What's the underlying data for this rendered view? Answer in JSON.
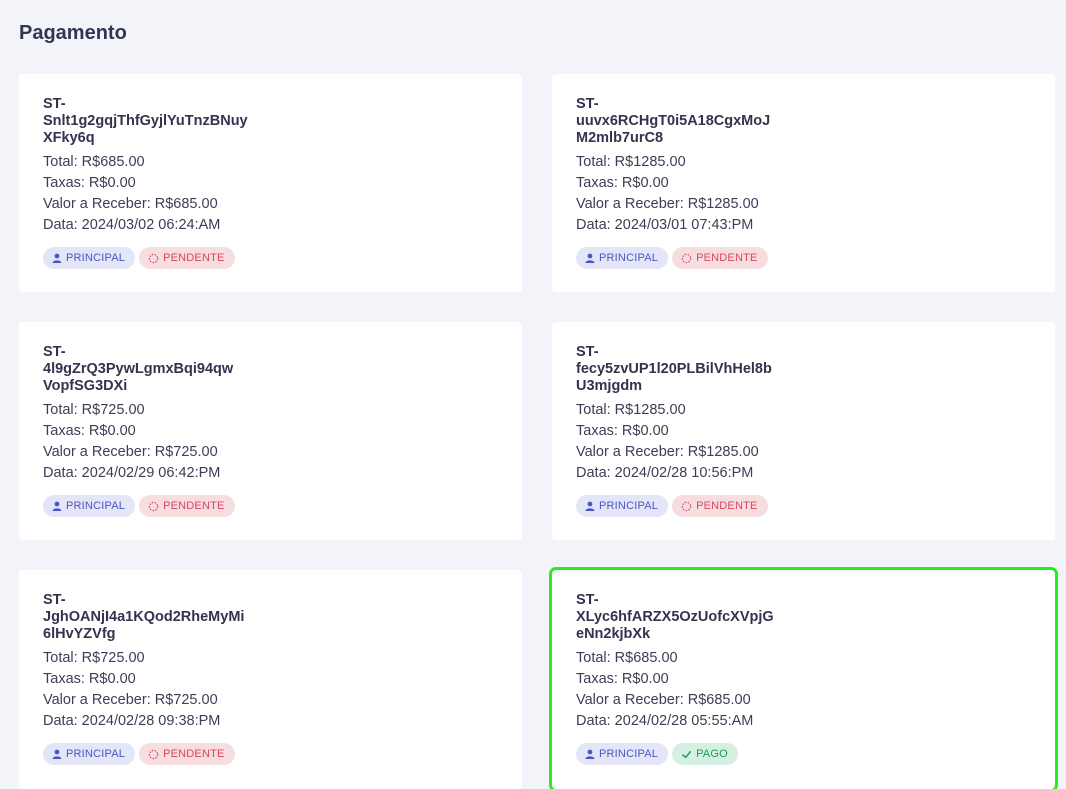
{
  "page": {
    "title": "Pagamento"
  },
  "labels": {
    "total": "Total: ",
    "taxas": "Taxas: ",
    "valor": "Valor a Receber: ",
    "data": "Data: "
  },
  "cards": [
    {
      "id": "ST-\nSnlt1g2gqjThfGyjlYuTnzBNuy\nXFky6q",
      "total": "Total: R$685.00",
      "taxas": "Taxas: R$0.00",
      "valor": "Valor a Receber: R$685.00",
      "data": "Data: 2024/03/02 06:24:AM",
      "type_badge": "PRINCIPAL",
      "status_badge": "PENDENTE",
      "status": "pending"
    },
    {
      "id": "ST-\nuuvx6RCHgT0i5A18CgxMoJ\nM2mlb7urC8",
      "total": "Total: R$1285.00",
      "taxas": "Taxas: R$0.00",
      "valor": "Valor a Receber: R$1285.00",
      "data": "Data: 2024/03/01 07:43:PM",
      "type_badge": "PRINCIPAL",
      "status_badge": "PENDENTE",
      "status": "pending"
    },
    {
      "id": "ST-\n4l9gZrQ3PywLgmxBqi94qw\nVopfSG3DXi",
      "total": "Total: R$725.00",
      "taxas": "Taxas: R$0.00",
      "valor": "Valor a Receber: R$725.00",
      "data": "Data: 2024/02/29 06:42:PM",
      "type_badge": "PRINCIPAL",
      "status_badge": "PENDENTE",
      "status": "pending"
    },
    {
      "id": "ST-\nfecy5zvUP1l20PLBilVhHel8b\nU3mjgdm",
      "total": "Total: R$1285.00",
      "taxas": "Taxas: R$0.00",
      "valor": "Valor a Receber: R$1285.00",
      "data": "Data: 2024/02/28 10:56:PM",
      "type_badge": "PRINCIPAL",
      "status_badge": "PENDENTE",
      "status": "pending"
    },
    {
      "id": "ST-\nJghOANjI4a1KQod2RheMyMi\n6lHvYZVfg",
      "total": "Total: R$725.00",
      "taxas": "Taxas: R$0.00",
      "valor": "Valor a Receber: R$725.00",
      "data": "Data: 2024/02/28 09:38:PM",
      "type_badge": "PRINCIPAL",
      "status_badge": "PENDENTE",
      "status": "pending"
    },
    {
      "id": "ST-\nXLyc6hfARZX5OzUofcXVpjG\neNn2kjbXk",
      "total": "Total: R$685.00",
      "taxas": "Taxas: R$0.00",
      "valor": "Valor a Receber: R$685.00",
      "data": "Data: 2024/02/28 05:55:AM",
      "type_badge": "PRINCIPAL",
      "status_badge": "PAGO",
      "status": "paid"
    }
  ],
  "icons": {
    "type": "user-icon",
    "pending": "spinner-icon",
    "paid": "check-icon"
  },
  "colors": {
    "selected_outline": "#22ee22",
    "pending_text": "#e0445b",
    "paid_text": "#1f9a57",
    "principal_text": "#4a55c7"
  }
}
